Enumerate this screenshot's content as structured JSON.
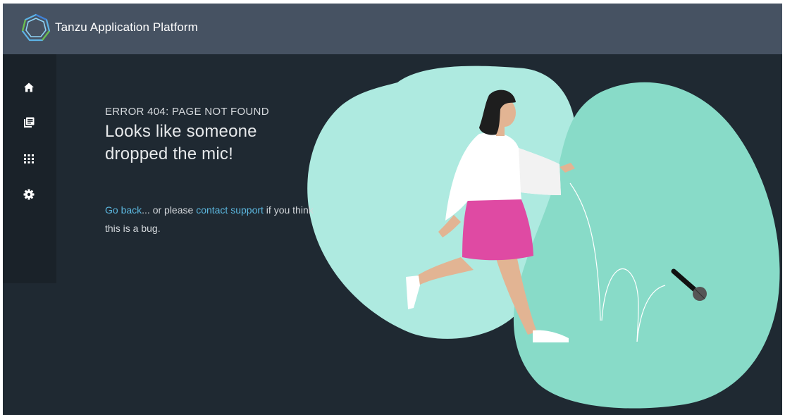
{
  "app": {
    "title": "Tanzu Application Platform",
    "logo_icon": "tanzu-logo-icon"
  },
  "sidebar": {
    "items": [
      {
        "name": "home",
        "icon": "home-icon"
      },
      {
        "name": "catalog",
        "icon": "library-icon"
      },
      {
        "name": "apis",
        "icon": "grid-icon"
      },
      {
        "name": "settings",
        "icon": "gear-icon"
      }
    ]
  },
  "error": {
    "code_line": "ERROR 404: PAGE NOT FOUND",
    "headline_line1": "Looks like someone",
    "headline_line2": "dropped the mic!",
    "go_back_link": "Go back",
    "middle_text": "... or please ",
    "contact_link": "contact support",
    "tail_text": " if you think this is a bug."
  },
  "colors": {
    "header_bg": "#465262",
    "page_bg": "#1f2932",
    "sidebar_bg": "#1a2229",
    "link": "#5cb8e0",
    "blob_light": "#aeeae0",
    "blob_dark": "#88dbc8",
    "skirt": "#df4aa3"
  }
}
